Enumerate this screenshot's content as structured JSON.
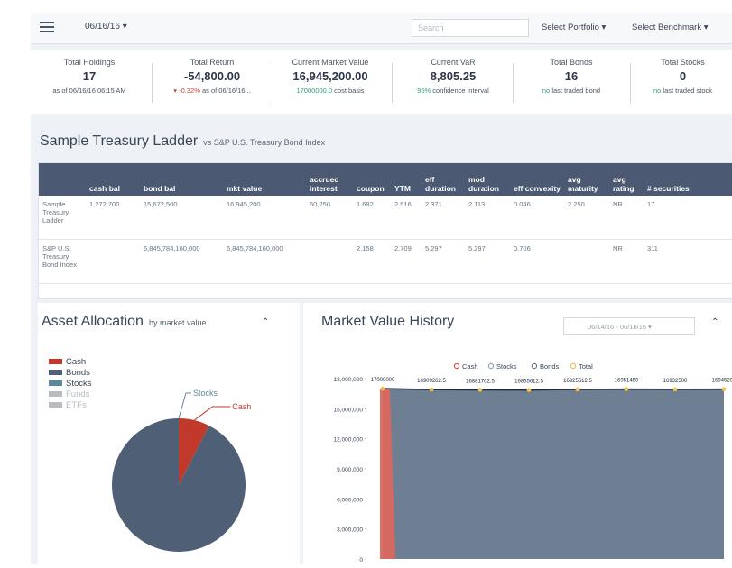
{
  "topbar": {
    "date": "06/16/16",
    "search_placeholder": "Search",
    "select_portfolio": "Select Portfolio",
    "select_benchmark": "Select Benchmark"
  },
  "kpis": [
    {
      "label": "Total Holdings",
      "value": "17",
      "sub": "as of 06/16/16 06:15 AM"
    },
    {
      "label": "Total Return",
      "value": "-54,800.00",
      "sub_colored": "▾ -0.32%",
      "sub": " as of 06/16/16..."
    },
    {
      "label": "Current Market Value",
      "value": "16,945,200.00",
      "sub_colored": "17000000.0",
      "sub": " cost basis"
    },
    {
      "label": "Current VaR",
      "value": "8,805.25",
      "sub_colored": "95%",
      "sub": " confidence interval"
    },
    {
      "label": "Total Bonds",
      "value": "16",
      "sub_colored": "no",
      "sub": " last traded bond"
    },
    {
      "label": "Total Stocks",
      "value": "0",
      "sub_colored": "no",
      "sub": " last traded stock"
    }
  ],
  "ladder": {
    "title": "Sample Treasury Ladder",
    "vs": "vs S&P U.S. Treasury Bond Index",
    "headers": [
      "",
      "cash bal",
      "bond bal",
      "mkt value",
      "accrued interest",
      "coupon",
      "YTM",
      "eff duration",
      "mod duration",
      "eff convexity",
      "avg maturity",
      "avg rating",
      "# securities"
    ],
    "rows": [
      [
        "Sample Treasury Ladder",
        "1,272,700",
        "15,672,500",
        "16,945,200",
        "60,250",
        "1.682",
        "2.516",
        "2.371",
        "2.113",
        "0.046",
        "2.250",
        "NR",
        "17"
      ],
      [
        "S&P U.S. Treasury Bond Index",
        "",
        "6,845,784,160,000",
        "6,845,784,160,000",
        "",
        "2.158",
        "2.709",
        "5.297",
        "5.297",
        "0.706",
        "",
        "NR",
        "311"
      ]
    ]
  },
  "allocation": {
    "title": "Asset Allocation",
    "subtitle": "by market value",
    "legend": [
      {
        "name": "Cash",
        "color": "#c0392b"
      },
      {
        "name": "Bonds",
        "color": "#4e5f76"
      },
      {
        "name": "Stocks",
        "color": "#5b8a9b"
      },
      {
        "name": "Funds",
        "color": "#b8bcc2"
      },
      {
        "name": "ETFs",
        "color": "#b8bcc2"
      }
    ],
    "pie_labels": {
      "stocks": "Stocks",
      "cash": "Cash"
    }
  },
  "history": {
    "title": "Market Value History",
    "range": "06/14/16 - 06/16/16",
    "legend": [
      {
        "name": "Cash",
        "color": "#d9534f"
      },
      {
        "name": "Stocks",
        "color": "#8fa8b0"
      },
      {
        "name": "Bonds",
        "color": "#6a7b91"
      },
      {
        "name": "Total",
        "color": "#f0c050"
      }
    ],
    "point_labels": [
      "17000000",
      "16909262.5",
      "16881762.5",
      "16865612.5",
      "16925612.5",
      "16951450",
      "16932500",
      "16945200"
    ]
  },
  "chart_data": [
    {
      "type": "pie",
      "title": "Asset Allocation",
      "labels": [
        "Cash",
        "Bonds",
        "Stocks",
        "Funds",
        "ETFs"
      ],
      "values": [
        1272700,
        15672500,
        0,
        0,
        0
      ]
    },
    {
      "type": "area",
      "title": "Market Value History",
      "ylim": [
        0,
        18000000
      ],
      "yticks": [
        "18,000,000",
        "15,000,000",
        "12,000,000",
        "9,000,000",
        "6,000,000",
        "3,000,000",
        "0"
      ],
      "series": [
        {
          "name": "Bonds",
          "values": [
            17000000,
            16909262.5,
            16881762.5,
            16865612.5,
            16925612.5,
            16951450,
            16932500,
            16945200
          ]
        },
        {
          "name": "Cash",
          "values": [
            17000000,
            0,
            0,
            0,
            0,
            0,
            0,
            0
          ]
        },
        {
          "name": "Total",
          "values": [
            17000000,
            16909262.5,
            16881762.5,
            16865612.5,
            16925612.5,
            16951450,
            16932500,
            16945200
          ]
        }
      ]
    }
  ]
}
